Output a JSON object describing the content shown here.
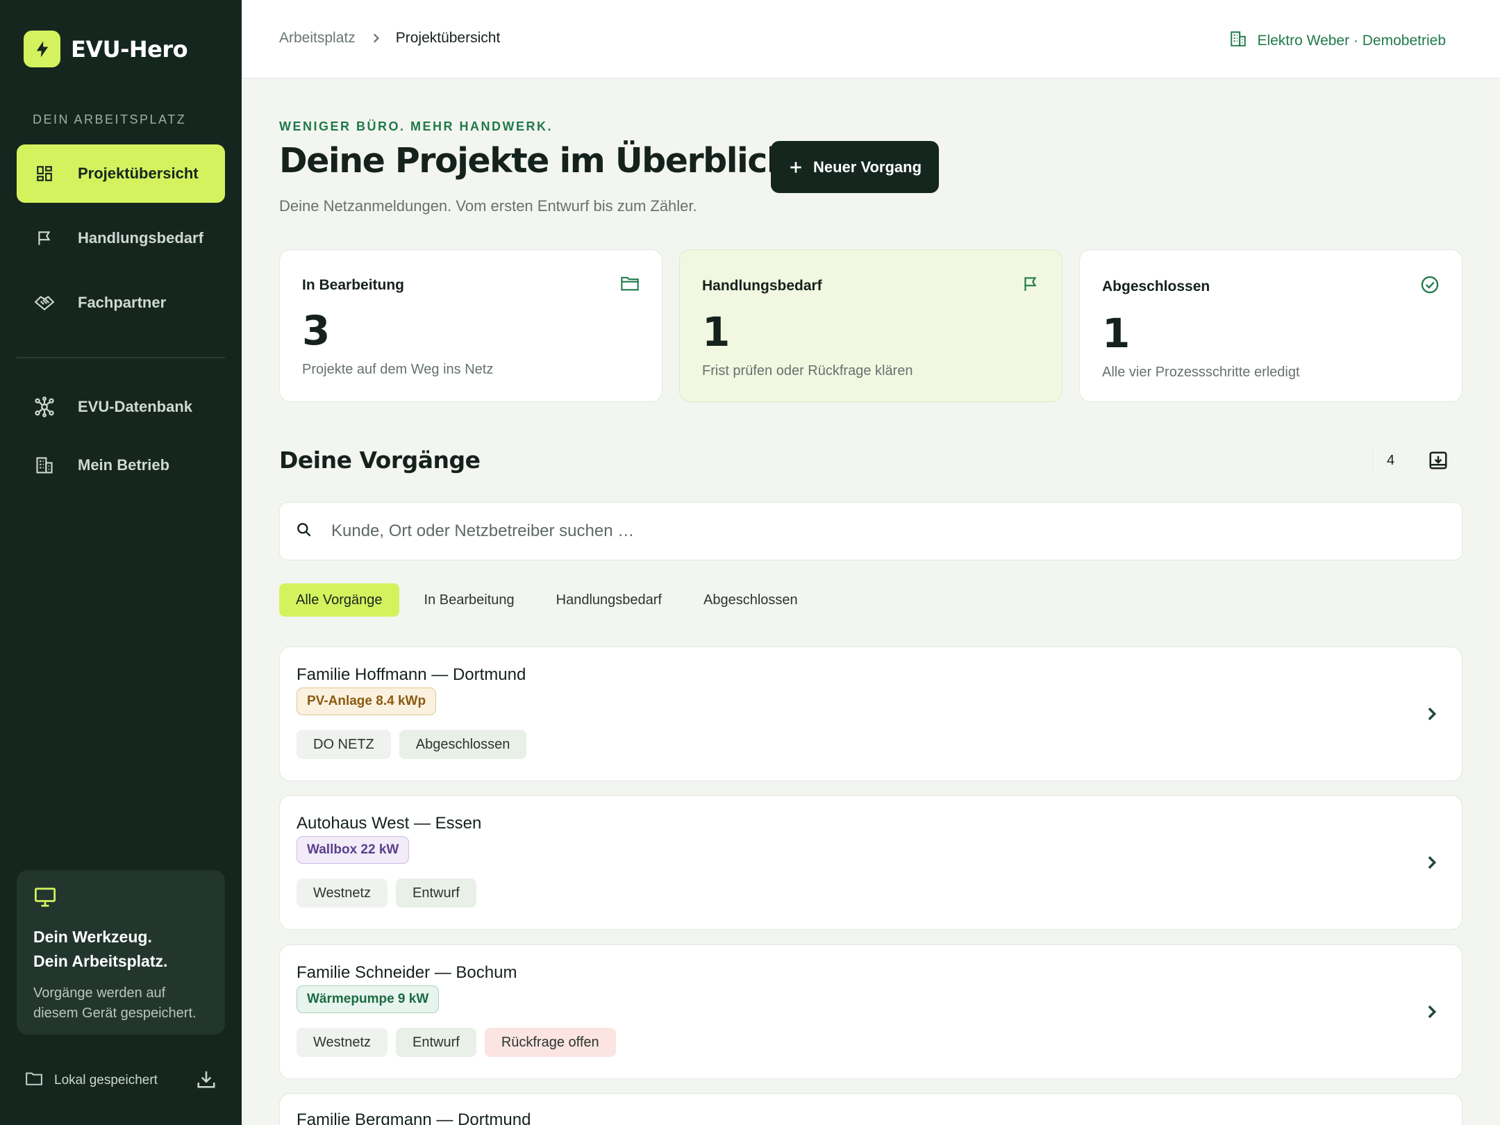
{
  "brand": {
    "name": "EVU-Hero",
    "accent": "#d4f25e",
    "sidebar_bg": "#15261f"
  },
  "sidebar": {
    "section_label": "DEIN ARBEITSPLATZ",
    "primary": [
      {
        "label": "Projektübersicht",
        "icon": "dashboard-icon",
        "active": true
      },
      {
        "label": "Handlungsbedarf",
        "icon": "flag-icon"
      },
      {
        "label": "Fachpartner",
        "icon": "handshake-icon"
      }
    ],
    "secondary": [
      {
        "label": "EVU-Datenbank",
        "icon": "network-icon"
      },
      {
        "label": "Mein Betrieb",
        "icon": "building-icon"
      }
    ],
    "promo": {
      "icon": "monitor-icon",
      "title_line1": "Dein Werkzeug.",
      "title_line2": "Dein Arbeitsplatz.",
      "text_line1": "Vorgänge werden auf",
      "text_line2": "diesem Gerät gespeichert."
    },
    "footer": {
      "label": "Lokal gespeichert",
      "icon": "folder-icon",
      "action_icon": "download-icon"
    }
  },
  "topbar": {
    "breadcrumb": [
      "Arbeitsplatz",
      "Projektübersicht"
    ],
    "company": "Elektro Weber · Demobetrieb"
  },
  "hero": {
    "eyebrow": "WENIGER BÜRO. MEHR HANDWERK.",
    "title": "Deine Projekte im Überblick.",
    "new_button": "Neuer Vorgang",
    "subtitle": "Deine Netzanmeldungen. Vom ersten Entwurf bis zum Zähler."
  },
  "stats": [
    {
      "label": "In Bearbeitung",
      "value": "3",
      "desc": "Projekte auf dem Weg ins Netz",
      "icon": "folder-icon"
    },
    {
      "label": "Handlungsbedarf",
      "value": "1",
      "desc": "Frist prüfen oder Rückfrage klären",
      "icon": "flag-icon"
    },
    {
      "label": "Abgeschlossen",
      "value": "1",
      "desc": "Alle vier Prozessschritte erledigt",
      "icon": "check-circle-icon"
    }
  ],
  "list": {
    "title": "Deine Vorgänge",
    "count": "4",
    "search_placeholder": "Kunde, Ort oder Netzbetreiber suchen …",
    "filters": [
      "Alle Vorgänge",
      "In Bearbeitung",
      "Handlungsbedarf",
      "Abgeschlossen"
    ],
    "active_filter": 0,
    "items": [
      {
        "title": "Familie Hoffmann — Dortmund",
        "type": "PV-Anlage 8.4 kWp",
        "operator": "DO NETZ",
        "status": "Abgeschlossen"
      },
      {
        "title": "Autohaus West — Essen",
        "type": "Wallbox 22 kW",
        "operator": "Westnetz",
        "status": "Entwurf"
      },
      {
        "title": "Familie Schneider — Bochum",
        "type": "Wärmepumpe 9 kW",
        "operator": "Westnetz",
        "status": "Entwurf",
        "warning": "Rückfrage offen"
      },
      {
        "title": "Familie Bergmann — Dortmund"
      }
    ]
  }
}
